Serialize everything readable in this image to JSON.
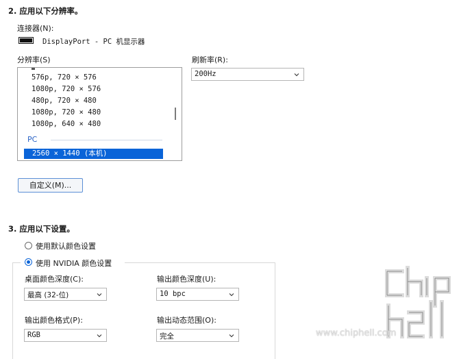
{
  "section2": {
    "heading": "2. 应用以下分辨率。",
    "connector_label": "连接器(N):",
    "connector_value": "DisplayPort - PC 机显示器",
    "resolution_label": "分辨率(S)",
    "resolution_items": [
      "576p, 720 × 576",
      "1080p, 720 × 576",
      "480p, 720 × 480",
      "1080p, 720 × 480",
      "1080p, 640 × 480"
    ],
    "pc_group_label": "PC",
    "selected_resolution": "2560 × 1440 (本机)",
    "refresh_label": "刷新率(R):",
    "refresh_value": "200Hz",
    "custom_button": "自定义(M)..."
  },
  "section3": {
    "heading": "3. 应用以下设置。",
    "radio_default": "使用默认颜色设置",
    "radio_nvidia": "使用 NVIDIA 颜色设置",
    "desktop_depth_label": "桌面颜色深度(C):",
    "desktop_depth_value": "最高 (32-位)",
    "output_depth_label": "输出颜色深度(U):",
    "output_depth_value": "10 bpc",
    "output_format_label": "输出颜色格式(P):",
    "output_format_value": "RGB",
    "dynamic_range_label": "输出动态范围(O):",
    "dynamic_range_value": "完全"
  },
  "watermark": {
    "site": "www.chiphell.com",
    "logo_icon": "chiphell-logo-icon"
  },
  "colors": {
    "selection": "#0a64d8",
    "group_label": "#2a63c6"
  }
}
